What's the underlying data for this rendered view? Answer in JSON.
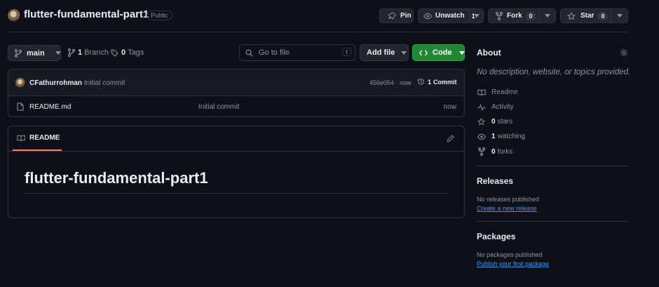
{
  "repo": {
    "name": "flutter-fundamental-part1",
    "visibility": "Public"
  },
  "header_actions": {
    "pin_label": "Pin",
    "unwatch_label": "Unwatch",
    "unwatch_count": "1",
    "fork_label": "Fork",
    "fork_count": "0",
    "star_label": "Star",
    "star_count": "0"
  },
  "toolbar": {
    "branch_selected": "main",
    "branches_count": "1",
    "branches_label": "Branch",
    "tags_count": "0",
    "tags_label": "Tags",
    "search_placeholder": "Go to file",
    "search_shortcut": "t",
    "add_file_label": "Add file",
    "code_label": "Code"
  },
  "latest_commit": {
    "author": "CFathurrohman",
    "message": "Initial commit",
    "hash_time": "456e054 · now",
    "commits_count": "1",
    "commits_label": "Commit"
  },
  "files": [
    {
      "name": "README.md",
      "message": "Initial commit",
      "time": "now"
    }
  ],
  "readme": {
    "tab_label": "README",
    "heading": "flutter-fundamental-part1"
  },
  "about": {
    "title": "About",
    "description": "No description, website, or topics provided.",
    "items": [
      {
        "icon": "book-icon",
        "label": "Readme"
      },
      {
        "icon": "pulse-icon",
        "label": "Activity"
      },
      {
        "icon": "star-icon",
        "count": "0",
        "label": "stars"
      },
      {
        "icon": "eye-icon",
        "count": "1",
        "label": "watching"
      },
      {
        "icon": "fork-icon",
        "count": "0",
        "label": "forks"
      }
    ]
  },
  "releases": {
    "title": "Releases",
    "empty_text": "No releases published",
    "link": "Create a new release"
  },
  "packages": {
    "title": "Packages",
    "empty_text": "No packages published",
    "link": "Publish your first package"
  },
  "colors": {
    "background": "#0d1117",
    "border": "#30363d",
    "button": "#21262d",
    "code_button": "#238636",
    "link": "#4493f8",
    "readme_tab_underline": "#f78166"
  }
}
